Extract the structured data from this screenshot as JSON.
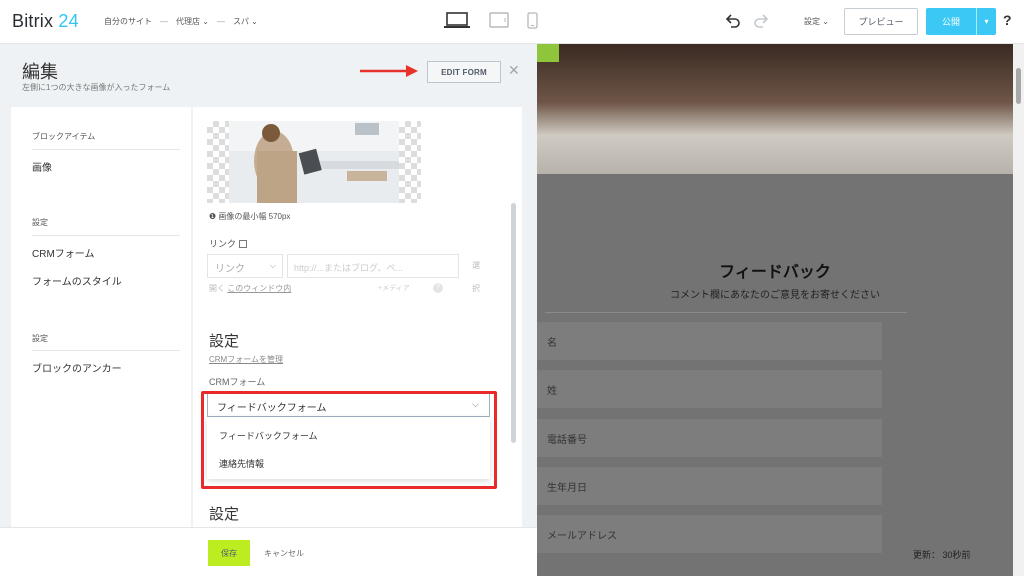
{
  "app": {
    "logo_text": "Bitrix",
    "logo_num": "24"
  },
  "topbar": {
    "crumbs": [
      "自分のサイト",
      "代理店",
      "スパ"
    ],
    "crumb_sep": "—",
    "settings_label": "設定",
    "preview_label": "プレビュー",
    "publish_label": "公開",
    "help_label": "?"
  },
  "editor": {
    "title": "編集",
    "subtitle": "左側に1つの大きな画像が入ったフォーム",
    "edit_form_label": "EDIT FORM",
    "close_label": "✕",
    "nav": {
      "section1": "ブロックアイテム",
      "item_image": "画像",
      "section2": "設定",
      "item_crm_form": "CRMフォーム",
      "item_form_style": "フォームのスタイル",
      "section3": "設定",
      "item_anchor": "ブロックのアンカー"
    },
    "content": {
      "image_hint": "画像の最小幅 570px",
      "link_label": "リンク",
      "link_select_value": "リンク",
      "link_input_placeholder": "http://...またはブログ、ペ...",
      "side_char1": "選",
      "side_char2": "択",
      "open_in_label": "開く",
      "open_in_value": "このウィンドウ内",
      "media_label": "+メディア",
      "settings_title": "設定",
      "crm_manage_link": "CRMフォームを管理",
      "crm_form_label": "CRMフォーム",
      "crm_selected": "フィードバックフォーム",
      "dropdown_options": [
        "フィードバックフォーム",
        "連絡先情報"
      ],
      "settings_title2": "設定"
    },
    "footer": {
      "save_label": "保存",
      "cancel_label": "キャンセル"
    }
  },
  "preview": {
    "form_title": "フィードバック",
    "form_subtitle": "コメント欄にあなたのご意見をお寄せください",
    "fields": [
      "名",
      "姓",
      "電話番号",
      "生年月日",
      "メールアドレス"
    ],
    "updated_text": "更新： 30秒前"
  },
  "colors": {
    "brand_blue": "#2fc6f6",
    "publish_bg": "#3bc8f5",
    "save_bg": "#bbed21",
    "highlight_red": "#ea2a2a",
    "preview_overlay": "#737373"
  }
}
